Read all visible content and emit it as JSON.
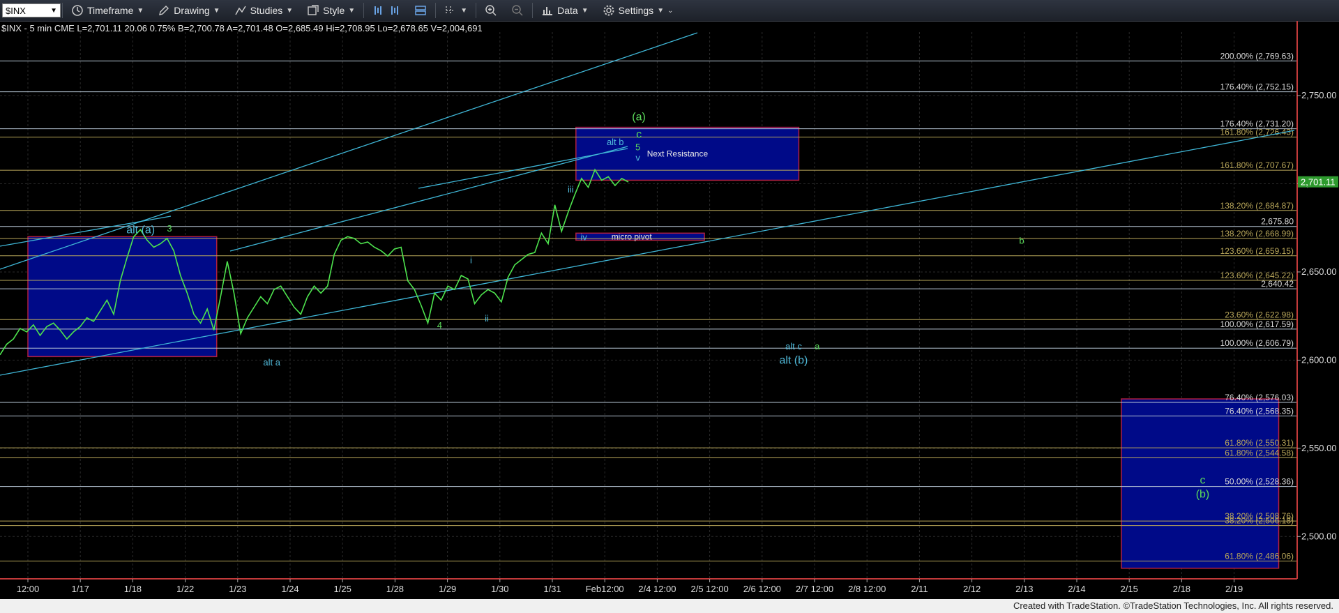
{
  "toolbar": {
    "symbol": "$INX",
    "timeframe": "Timeframe",
    "drawing": "Drawing",
    "studies": "Studies",
    "style": "Style",
    "data": "Data",
    "settings": "Settings"
  },
  "quote": {
    "symbol_line": "$INX - 5 min  CME  L=2,701.11  20.06  0.75%   B=2,700.78   A=2,701.48   O=2,685.49   Hi=2,708.95   Lo=2,678.65   V=2,004,691"
  },
  "footer": "Created with TradeStation. ©TradeStation Technologies, Inc. All rights reserved.",
  "chart_data": {
    "type": "line",
    "title": "$INX - 5 min",
    "y_ticks": [
      2500,
      2550,
      2600,
      2650,
      2700,
      2750
    ],
    "y_tick_labels": [
      "2,500.00",
      "2,550.00",
      "2,600.00",
      "2,650.00",
      "2,700.00",
      "2,750.00"
    ],
    "ylim": [
      2476,
      2786
    ],
    "last_price": 2701.11,
    "last_price_label": "2,701.11",
    "x_ticks": [
      "12:00",
      "1/17",
      "1/18",
      "1/22",
      "1/23",
      "1/24",
      "1/25",
      "1/28",
      "1/29",
      "1/30",
      "1/31",
      "Feb12:00",
      "2/4 12:00",
      "2/5 12:00",
      "2/6 12:00",
      "2/7 12:00",
      "2/8 12:00",
      "2/11",
      "2/12",
      "2/13",
      "2/14",
      "2/15",
      "2/18",
      "2/19"
    ],
    "series": [
      {
        "values": [
          2603,
          2609,
          2612,
          2618,
          2616,
          2620,
          2614,
          2619,
          2621,
          2617,
          2612,
          2616,
          2619,
          2624,
          2622,
          2628,
          2634,
          2626,
          2645,
          2658,
          2670,
          2674,
          2668,
          2664,
          2666,
          2669,
          2662,
          2648,
          2638,
          2626,
          2621,
          2629,
          2617,
          2636,
          2656,
          2638,
          2615,
          2624,
          2630,
          2636,
          2632,
          2640,
          2642,
          2636,
          2630,
          2626,
          2636,
          2642,
          2638,
          2642,
          2660,
          2668,
          2670,
          2669,
          2666,
          2667,
          2664,
          2662,
          2659,
          2663,
          2664,
          2645,
          2640,
          2631,
          2621,
          2638,
          2634,
          2642,
          2640,
          2648,
          2646,
          2632,
          2637,
          2640,
          2638,
          2633,
          2647,
          2654,
          2657,
          2660,
          2661,
          2672,
          2666,
          2688,
          2673,
          2684,
          2694,
          2703,
          2698,
          2708,
          2702,
          2704,
          2699,
          2703,
          2701
        ],
        "x_end_days": 15.97
      }
    ],
    "horizontal_levels": [
      {
        "label": "200.00% (2,769.63)",
        "value": 2769.63
      },
      {
        "label": "176.40% (2,752.15)",
        "value": 2752.15
      },
      {
        "label": "176.40% (2,731.20)",
        "value": 2731.2
      },
      {
        "label": "161.80% (2,726.43)",
        "value": 2726.43
      },
      {
        "label": "161.80% (2,707.67)",
        "value": 2707.67
      },
      {
        "label": "138.20% (2,684.87)",
        "value": 2684.87
      },
      {
        "label": "2,675.80",
        "value": 2675.8
      },
      {
        "label": "138.20% (2,668.99)",
        "value": 2668.99
      },
      {
        "label": "123.60% (2,659.15)",
        "value": 2659.15
      },
      {
        "label": "123.60% (2,645.22)",
        "value": 2645.22
      },
      {
        "label": "2,640.42",
        "value": 2640.42
      },
      {
        "label": "23.60% (2,622.98)",
        "value": 2622.98
      },
      {
        "label": "100.00% (2,617.59)",
        "value": 2617.59
      },
      {
        "label": "100.00% (2,606.79)",
        "value": 2606.79
      },
      {
        "label": "76.40% (2,576.03)",
        "value": 2576.03
      },
      {
        "label": "76.40% (2,568.35)",
        "value": 2568.35
      },
      {
        "label": "61.80% (2,550.31)",
        "value": 2550.31
      },
      {
        "label": "61.80% (2,544.58)",
        "value": 2544.58
      },
      {
        "label": "50.00% (2,528.36)",
        "value": 2528.36
      },
      {
        "label": "38.20% (2,508.76)",
        "value": 2508.76
      },
      {
        "label": "38.20% (2,506.18)",
        "value": 2506.18
      },
      {
        "label": "61.80% (2,486.06)",
        "value": 2486.06
      }
    ],
    "boxes": [
      {
        "label": "",
        "x0": 0,
        "x1": 3.6,
        "y0": 2602,
        "y1": 2670
      },
      {
        "label": "Next Resistance",
        "x0": 10.45,
        "x1": 14.7,
        "y0": 2702,
        "y1": 2732
      },
      {
        "label": "micro pivot",
        "x0": 10.45,
        "x1": 12.9,
        "y0": 2668,
        "y1": 2672
      },
      {
        "label": "",
        "x0": 20.85,
        "x1": 23.85,
        "y0": 2482,
        "y1": 2578
      }
    ],
    "wave_labels": [
      {
        "text": "alt (a)",
        "x": 2.15,
        "y": 2672
      },
      {
        "text": "3",
        "x": 2.7,
        "y": 2673
      },
      {
        "text": "alt a",
        "x": 4.65,
        "y": 2597
      },
      {
        "text": "4",
        "x": 7.85,
        "y": 2618
      },
      {
        "text": "i",
        "x": 8.45,
        "y": 2655
      },
      {
        "text": "ii",
        "x": 8.75,
        "y": 2622
      },
      {
        "text": "iii",
        "x": 10.35,
        "y": 2695
      },
      {
        "text": "iv",
        "x": 10.6,
        "y": 2668
      },
      {
        "text": "v",
        "x": 11.63,
        "y": 2713
      },
      {
        "text": "5",
        "x": 11.63,
        "y": 2719
      },
      {
        "text": "c",
        "x": 11.65,
        "y": 2726
      },
      {
        "text": "alt b",
        "x": 11.2,
        "y": 2722
      },
      {
        "text": "(a)",
        "x": 11.65,
        "y": 2736
      },
      {
        "text": "alt c",
        "x": 14.6,
        "y": 2606
      },
      {
        "text": "a",
        "x": 15.05,
        "y": 2606
      },
      {
        "text": "alt (b)",
        "x": 14.6,
        "y": 2598
      },
      {
        "text": "b",
        "x": 18.95,
        "y": 2666
      },
      {
        "text": "c",
        "x": 22.4,
        "y": 2530
      },
      {
        "text": "(b)",
        "x": 22.4,
        "y": 2522
      }
    ]
  },
  "colors": {
    "price": "#4ee44e",
    "channel": "#3fb6d6",
    "level": "#b8c7d6",
    "level_gold": "#b9a75a",
    "box_fill": "#000a88",
    "box_border": "#b02040",
    "axis": "#c23a3a",
    "label_cyan": "#4fb9d9",
    "label_green": "#5bd95b"
  },
  "icons": [
    "chart-window-icon",
    "drawing-pencil-icon",
    "studies-icon",
    "style-icon",
    "bar-spacing-icon",
    "window-icon",
    "magnifier-icon",
    "data-icon",
    "gear-icon"
  ]
}
